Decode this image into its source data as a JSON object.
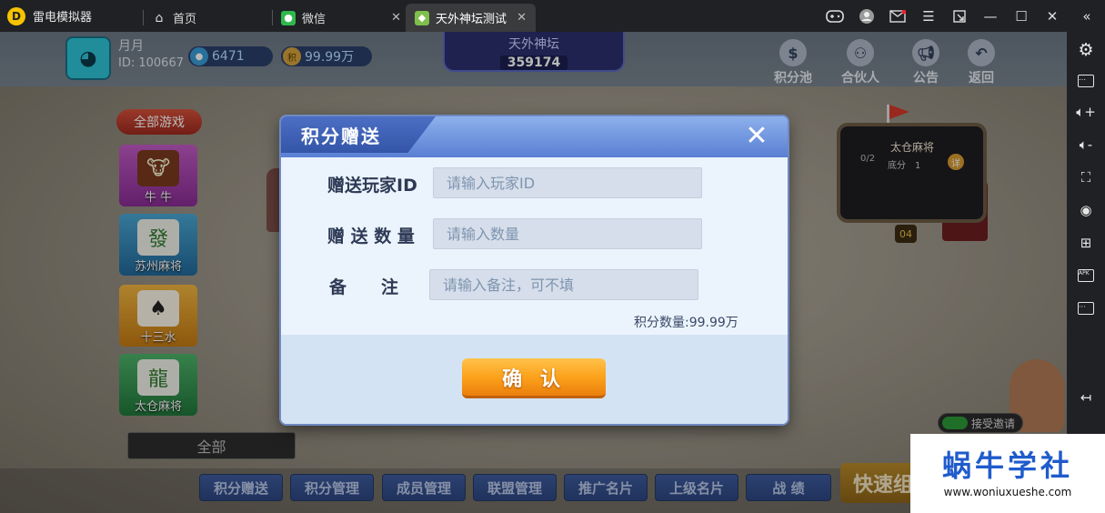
{
  "app": {
    "title": "雷电模拟器",
    "logo_text": "D"
  },
  "tabs": [
    {
      "label": "首页",
      "icon": "home-icon"
    },
    {
      "label": "微信",
      "icon": "wechat-icon"
    },
    {
      "label": "天外神坛测试",
      "icon": "game-icon",
      "active": true
    }
  ],
  "player": {
    "name": "月月",
    "id": "ID: 100667",
    "diamonds": "6471",
    "points": "99.99万",
    "points_coin": "积"
  },
  "banner": {
    "title": "天外神坛",
    "value": "359174"
  },
  "top_icons": [
    "积分池",
    "合伙人",
    "公告",
    "返回"
  ],
  "game_menu": {
    "all": "全部游戏",
    "items": [
      "牛 牛",
      "苏州麻将",
      "十三水",
      "太仓麻将"
    ],
    "filter": "全部"
  },
  "table": {
    "name": "太仓麻将",
    "count": "0/2",
    "base": "底分　1",
    "detail": "详",
    "number": "04"
  },
  "invite": "接受邀请",
  "bottom_menu": [
    "积分赠送",
    "积分管理",
    "成员管理",
    "联盟管理",
    "推广名片",
    "上级名片",
    "战 绩"
  ],
  "quick_start": "快速组",
  "dialog": {
    "title": "积分赠送",
    "close": "✕",
    "fields": [
      {
        "label": "赠送玩家ID",
        "placeholder": "请输入玩家ID"
      },
      {
        "label": "赠 送 数 量",
        "placeholder": "请输入数量"
      },
      {
        "label": "备　　注",
        "placeholder": "请输入备注，可不填"
      }
    ],
    "score_info": "积分数量:99.99万",
    "confirm": "确 认"
  },
  "watermark": {
    "title": "蜗牛学社",
    "url": "www.woniuxueshe.com"
  },
  "colors": {
    "accent": "#5a7fd3",
    "confirm": "#fca21c",
    "watermark": "#1f5bcc"
  }
}
